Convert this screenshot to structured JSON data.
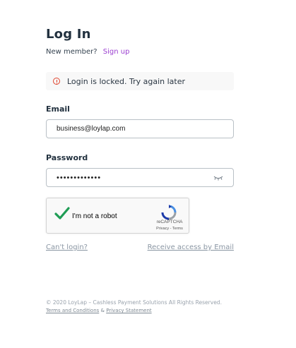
{
  "header": {
    "title": "Log In",
    "new_member_text": "New member?",
    "signup_link": "Sign up"
  },
  "alert": {
    "icon": "error-circle-icon",
    "message": "Login is locked. Try again later",
    "color": "#e0442e"
  },
  "form": {
    "email_label": "Email",
    "email_value": "business@loylap.com",
    "password_label": "Password",
    "password_value": "•••••••••••••",
    "show_password_icon": "eye-closed-icon"
  },
  "captcha": {
    "checked": true,
    "label": "I'm not a robot",
    "brand": "reCAPTCHA",
    "privacy": "Privacy",
    "separator": " - ",
    "terms": "Terms"
  },
  "links": {
    "cant_login": "Can't login?",
    "receive_access": "Receive access by Email"
  },
  "footer": {
    "copyright": "© 2020 LoyLap – Cashless Payment Solutions All Rights Reserved.",
    "terms": "Terms and Conditions",
    "and": " & ",
    "privacy": "Privacy Statement"
  },
  "colors": {
    "accent": "#9b3fd0",
    "check": "#1f9d55",
    "link": "#8a96a3"
  }
}
